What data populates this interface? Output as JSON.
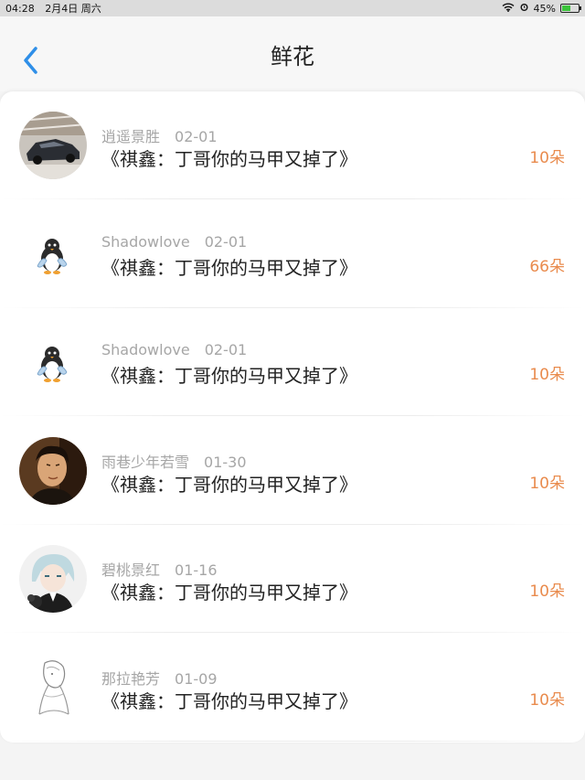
{
  "status_bar": {
    "time": "04:28",
    "date": "2月4日 周六",
    "battery": "45%",
    "battery_level": 0.45
  },
  "nav": {
    "title": "鲜花"
  },
  "colors": {
    "accent_blue": "#2f8fe8",
    "count_orange": "#e98b4d",
    "meta_gray": "#a6a6a6"
  },
  "items": [
    {
      "user": "逍遥景胜",
      "date": "02-01",
      "title": "《祺鑫：丁哥你的马甲又掉了》",
      "count": "10朵",
      "avatar": "car-avatar"
    },
    {
      "user": "Shadowlove",
      "date": "02-01",
      "title": "《祺鑫：丁哥你的马甲又掉了》",
      "count": "66朵",
      "avatar": "penguin-avatar"
    },
    {
      "user": "Shadowlove",
      "date": "02-01",
      "title": "《祺鑫：丁哥你的马甲又掉了》",
      "count": "10朵",
      "avatar": "penguin-avatar"
    },
    {
      "user": "雨巷少年若雪",
      "date": "01-30",
      "title": "《祺鑫：丁哥你的马甲又掉了》",
      "count": "10朵",
      "avatar": "portrait-avatar"
    },
    {
      "user": "碧桃景红",
      "date": "01-16",
      "title": "《祺鑫：丁哥你的马甲又掉了》",
      "count": "10朵",
      "avatar": "anime-avatar"
    },
    {
      "user": "那拉艳芳",
      "date": "01-09",
      "title": "《祺鑫：丁哥你的马甲又掉了》",
      "count": "10朵",
      "avatar": "sketch-avatar"
    }
  ]
}
